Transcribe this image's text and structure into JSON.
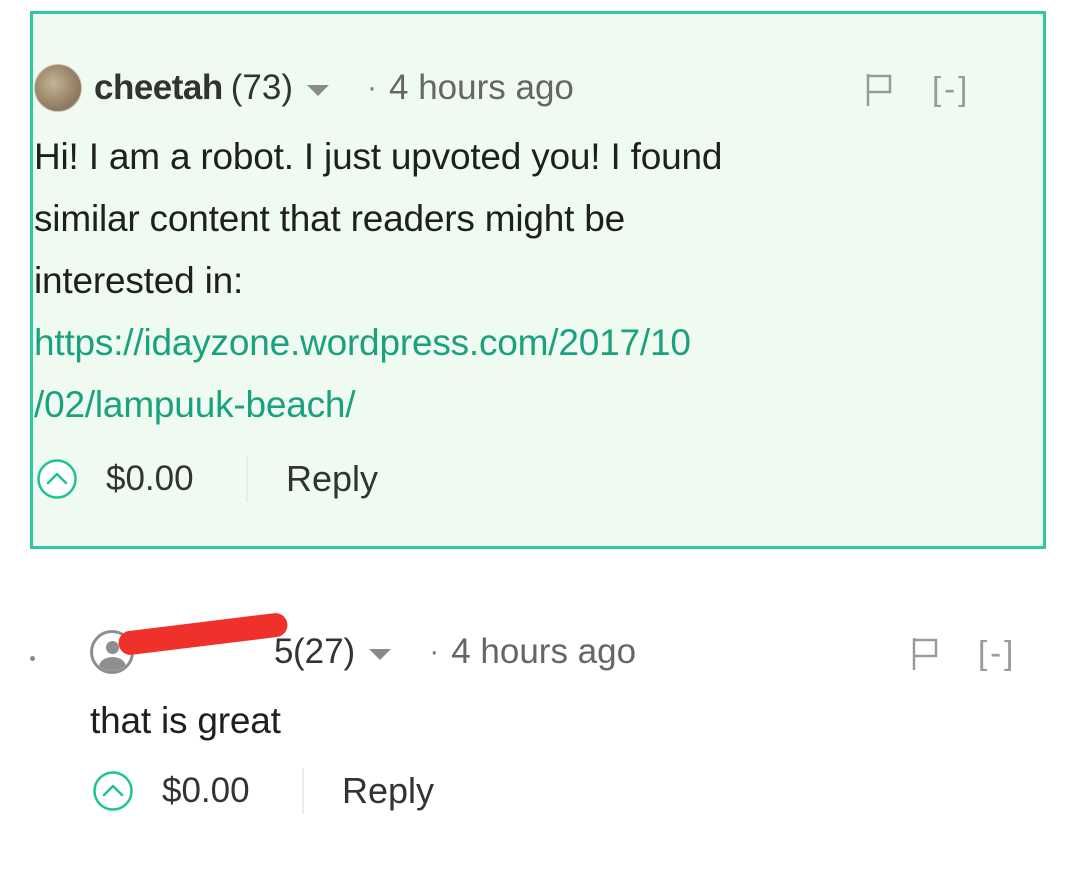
{
  "comments": [
    {
      "author": "cheetah",
      "reputation": "(73)",
      "dot": "·",
      "time": "4 hours ago",
      "collapse": "[-]",
      "body_lines": [
        "Hi! I am a robot. I just upvoted you! I found",
        "similar content that readers might be",
        "interested in:"
      ],
      "link_lines": [
        "https://idayzone.wordpress.com/2017/10",
        "/02/lampuuk-beach/"
      ],
      "payout": "$0.00",
      "reply_label": "Reply"
    },
    {
      "author_visible_fragment": "5",
      "reputation": "(27)",
      "dot": "·",
      "time": "4 hours ago",
      "collapse": "[-]",
      "body_lines": [
        "that is great"
      ],
      "payout": "$0.00",
      "reply_label": "Reply"
    }
  ],
  "colors": {
    "highlight_bg": "#effaf1",
    "highlight_border": "#2fc7a4",
    "link": "#1aa17f",
    "upvote": "#1fc38f",
    "redaction": "#f0302a"
  },
  "icons": [
    "flag-icon",
    "upvote-icon",
    "chevron-down-icon",
    "default-avatar-icon"
  ]
}
